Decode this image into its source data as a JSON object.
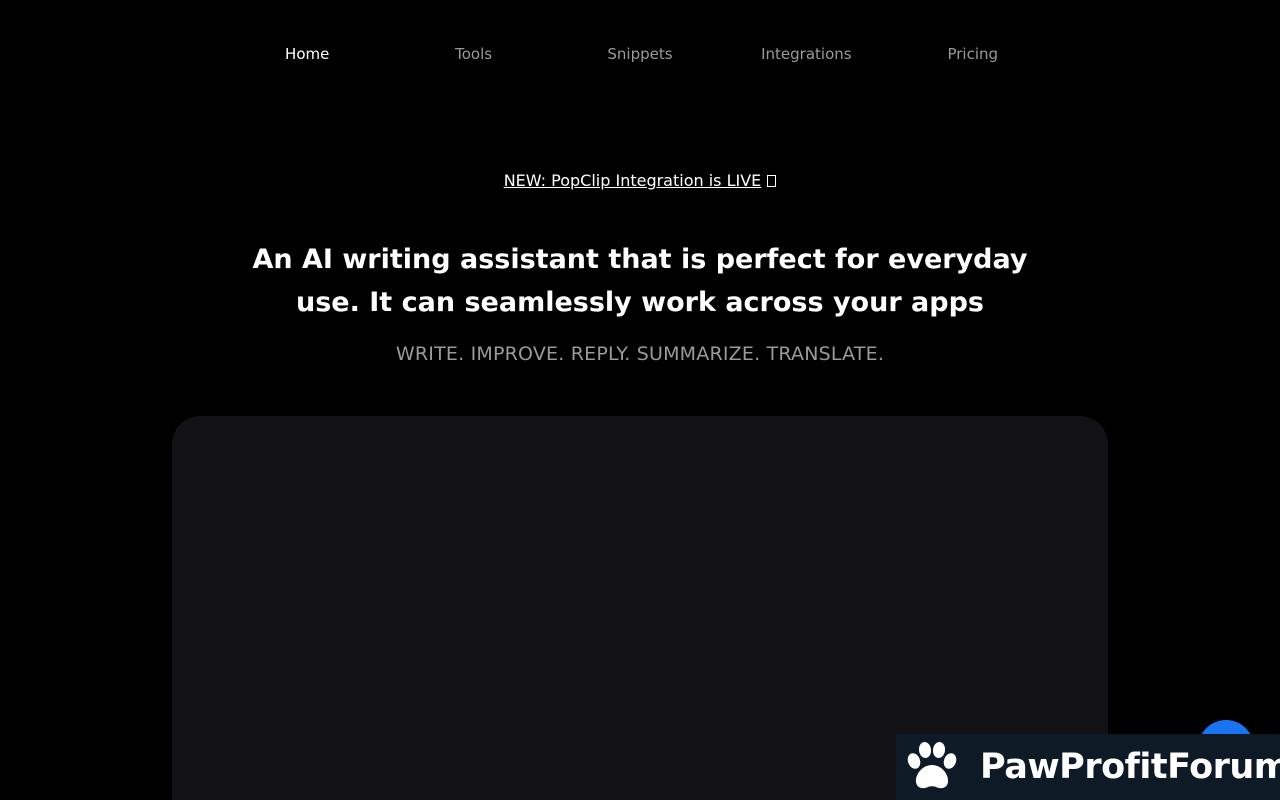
{
  "nav": {
    "items": [
      {
        "label": "Home",
        "active": true
      },
      {
        "label": "Tools",
        "active": false
      },
      {
        "label": "Snippets",
        "active": false
      },
      {
        "label": "Integrations",
        "active": false
      },
      {
        "label": "Pricing",
        "active": false
      }
    ]
  },
  "hero": {
    "announcement": "NEW: PopClip Integration is LIVE",
    "headline": "An AI writing assistant that is perfect for everyday use. It can seamlessly work across your apps",
    "tagline": "WRITE. IMPROVE. REPLY. SUMMARIZE. TRANSLATE."
  },
  "watermark": {
    "text": "PawProfitForum",
    "icon": "paw-icon"
  },
  "chat": {
    "icon": "chat-icon"
  },
  "colors": {
    "background": "#000000",
    "nav_active": "#ffffff",
    "nav_inactive": "#9a9a9a",
    "panel": "#111116",
    "chat_button": "#1a73f0",
    "watermark_bg": "#0e1a26"
  }
}
